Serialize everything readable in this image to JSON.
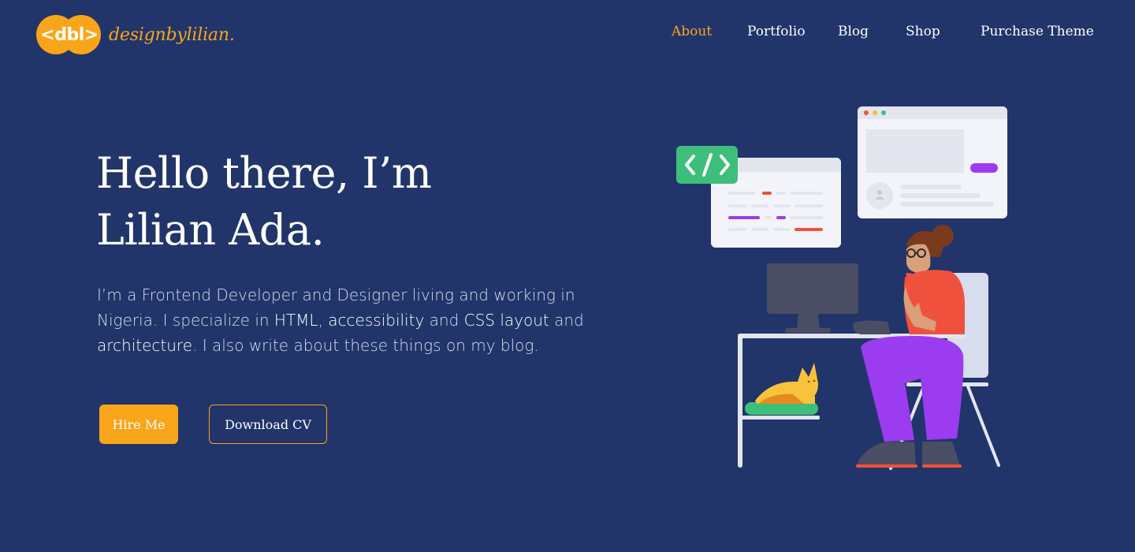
{
  "logo": {
    "mark": "<dbl>",
    "text": "designbylilian."
  },
  "nav": {
    "items": [
      {
        "label": "About",
        "active": true
      },
      {
        "label": "Portfolio",
        "active": false
      },
      {
        "label": "Blog",
        "active": false
      },
      {
        "label": "Shop",
        "active": false
      },
      {
        "label": "Purchase Theme",
        "active": false
      }
    ]
  },
  "hero": {
    "headline_line1": "Hello there, I’m",
    "headline_line2": "Lilian Ada.",
    "bio": {
      "part1": "I’m a  Frontend Developer and Designer living and working in Nigeria. I specialize in ",
      "hl1": "HTML",
      "part2": ", ",
      "hl2": "accessibility",
      "part3": " and ",
      "hl3": "CSS layout",
      "part4": " and ",
      "hl4": "architecture",
      "part5": ". I also write about these things on my blog."
    },
    "hire_label": "Hire Me",
    "cv_label": "Download CV"
  },
  "illustration": {
    "code_icon": "</>",
    "icons": [
      "code-icon",
      "user-icon"
    ]
  },
  "colors": {
    "background": "#21356a",
    "accent": "#f9a51a",
    "green": "#3dbf7a",
    "purple": "#9b3cf0",
    "red": "#f0513c"
  }
}
